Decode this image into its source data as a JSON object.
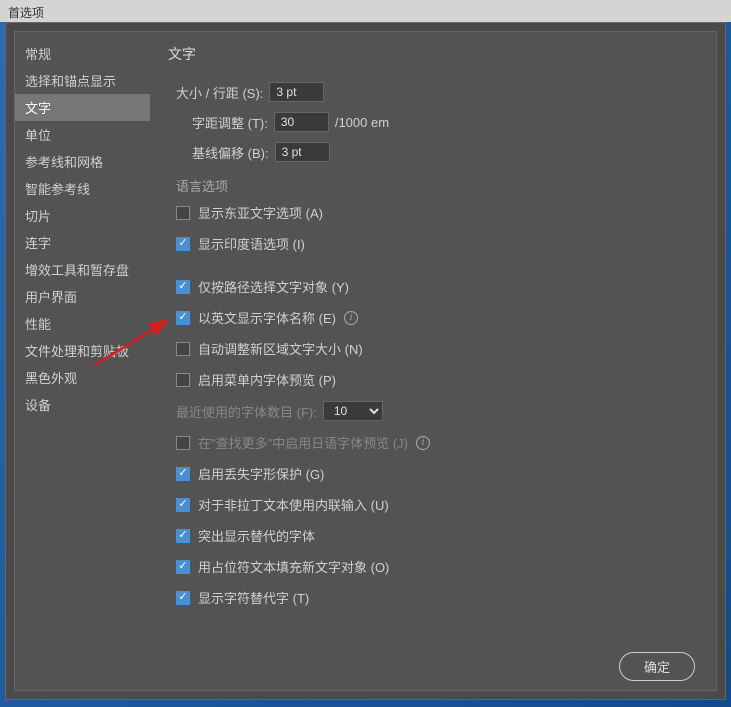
{
  "title": "首选项",
  "sidebar": {
    "items": [
      {
        "label": "常规"
      },
      {
        "label": "选择和锚点显示"
      },
      {
        "label": "文字"
      },
      {
        "label": "单位"
      },
      {
        "label": "参考线和网格"
      },
      {
        "label": "智能参考线"
      },
      {
        "label": "切片"
      },
      {
        "label": "连字"
      },
      {
        "label": "增效工具和暂存盘"
      },
      {
        "label": "用户界面"
      },
      {
        "label": "性能"
      },
      {
        "label": "文件处理和剪贴板"
      },
      {
        "label": "黑色外观"
      },
      {
        "label": "设备"
      }
    ],
    "activeIndex": 2
  },
  "content": {
    "title": "文字",
    "fields": {
      "size": {
        "label": "大小 / 行距 (S):",
        "value": "3 pt"
      },
      "tracking": {
        "label": "字距调整 (T):",
        "value": "30",
        "unit": "/1000 em"
      },
      "baseline": {
        "label": "基线偏移 (B):",
        "value": "3 pt"
      }
    },
    "langSection": "语言选项",
    "checks": {
      "eastAsian": {
        "label": "显示东亚文字选项 (A)",
        "checked": false
      },
      "indic": {
        "label": "显示印度语选项 (I)",
        "checked": true
      },
      "pathSelect": {
        "label": "仅按路径选择文字对象 (Y)",
        "checked": true
      },
      "englishFont": {
        "label": "以英文显示字体名称 (E)",
        "checked": true
      },
      "autoSize": {
        "label": "自动调整新区域文字大小 (N)",
        "checked": false
      },
      "menuPreview": {
        "label": "启用菜单内字体预览 (P)",
        "checked": false
      },
      "recentFonts": {
        "label": "最近使用的字体数目 (F):",
        "value": "10"
      },
      "japanese": {
        "label": "在\"查找更多\"中启用日语字体预览 (J)",
        "checked": false
      },
      "missingGlyph": {
        "label": "启用丢失字形保护 (G)",
        "checked": true
      },
      "inlineInput": {
        "label": "对于非拉丁文本使用内联输入 (U)",
        "checked": true
      },
      "highlight": {
        "label": "突出显示替代的字体",
        "checked": true
      },
      "placeholder": {
        "label": "用占位符文本填充新文字对象 (O)",
        "checked": true
      },
      "altGlyph": {
        "label": "显示字符替代字 (T)",
        "checked": true
      }
    }
  },
  "buttons": {
    "ok": "确定"
  }
}
